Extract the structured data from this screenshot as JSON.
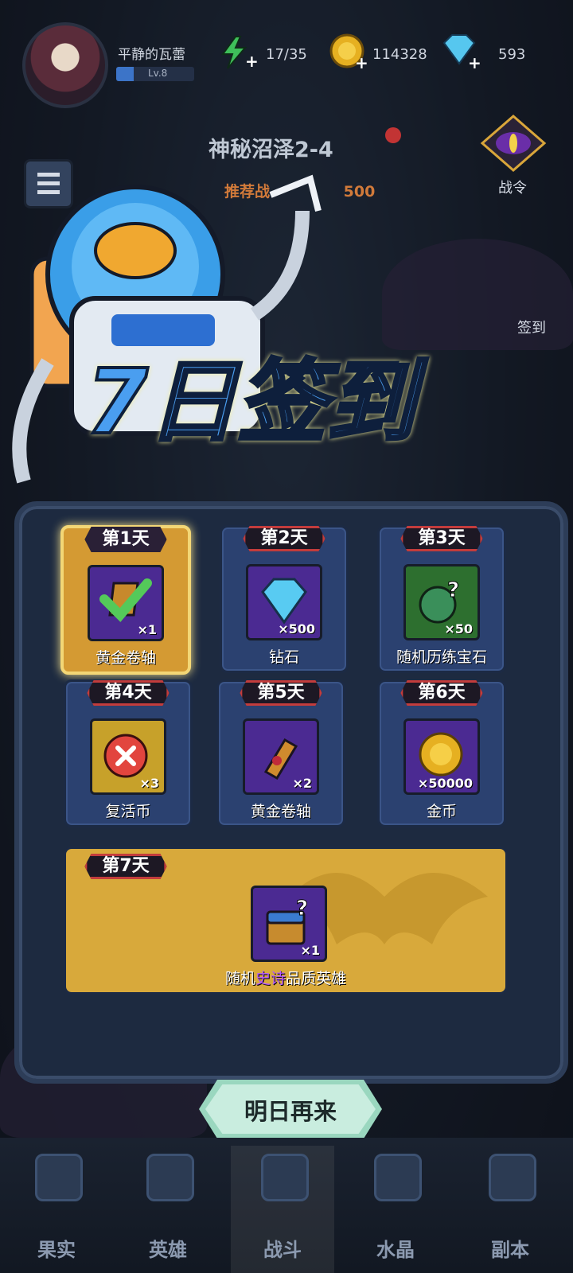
{
  "player": {
    "name": "平静的瓦蕾",
    "level": "Lv.8"
  },
  "resources": {
    "energy": {
      "value": "17/35",
      "icon": "lightning-icon"
    },
    "gold": {
      "value": "114328",
      "icon": "gold-coin-icon"
    },
    "gems": {
      "value": "593",
      "icon": "diamond-icon"
    }
  },
  "stage": {
    "title": "神秘沼泽2-4",
    "recommend_prefix": "推荐战",
    "recommend_value": "500"
  },
  "side_buttons": {
    "battle_pass": "战令",
    "sign_in": "签到"
  },
  "banner": {
    "title": "7日签到"
  },
  "signin": {
    "days": [
      {
        "label": "第1天",
        "item": "黄金卷轴",
        "qty": "×1",
        "icon": "gold-scroll-icon",
        "claimed": true
      },
      {
        "label": "第2天",
        "item": "钻石",
        "qty": "×500",
        "icon": "diamond-icon",
        "claimed": false
      },
      {
        "label": "第3天",
        "item": "随机历练宝石",
        "qty": "×50",
        "icon": "mystery-gem-icon",
        "claimed": false
      },
      {
        "label": "第4天",
        "item": "复活币",
        "qty": "×3",
        "icon": "revive-coin-icon",
        "claimed": false
      },
      {
        "label": "第5天",
        "item": "黄金卷轴",
        "qty": "×2",
        "icon": "gold-scroll-icon",
        "claimed": false
      },
      {
        "label": "第6天",
        "item": "金币",
        "qty": "×50000",
        "icon": "gold-coin-icon",
        "claimed": false
      }
    ],
    "day7": {
      "label": "第7天",
      "item_prefix": "随机",
      "item_highlight": "史诗",
      "item_suffix": "品质英雄",
      "qty": "×1",
      "icon": "mystery-hero-chest-icon"
    },
    "claim_button": "明日再来"
  },
  "nav": [
    {
      "label": "果实",
      "icon": "fruit-icon"
    },
    {
      "label": "英雄",
      "icon": "hero-icon"
    },
    {
      "label": "战斗",
      "icon": "battle-icon"
    },
    {
      "label": "水晶",
      "icon": "crystal-icon"
    },
    {
      "label": "副本",
      "icon": "dungeon-icon"
    }
  ],
  "colors": {
    "highlight_epic": "#b65bff",
    "panel": "#1d2a40",
    "card": "#2b4170",
    "gold_card": "#d49a33"
  }
}
